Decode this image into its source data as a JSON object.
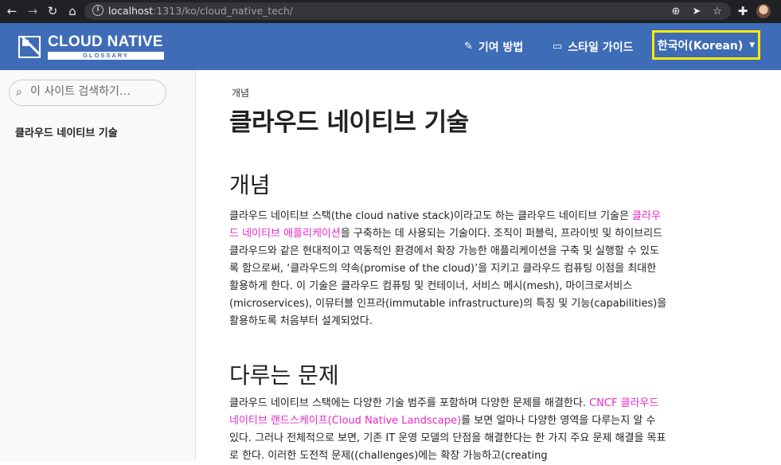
{
  "browser": {
    "url_host": "localhost",
    "url_rest": ":1313/ko/cloud_native_tech/"
  },
  "header": {
    "logo_title": "CLOUD NATIVE",
    "logo_subtitle": "GLOSSARY",
    "nav_contribute": "기여 방법",
    "nav_style_guide": "스타일 가이드",
    "language": "한국어(Korean)"
  },
  "sidebar": {
    "search_placeholder": "이 사이트 검색하기…",
    "item": "클라우드 네이티브 기술"
  },
  "content": {
    "breadcrumb": "개념",
    "title": "클라우드 네이티브 기술",
    "section1_heading": "개념",
    "p1_a": "클라우드 네이티브 스택(the cloud native stack)이라고도 하는 클라우드 네이티브 기술은 ",
    "p1_link": "클라우드 네이티브 애플리케이션",
    "p1_b": "을 구축하는 데 사용되는 기술이다. 조직이 퍼블릭, 프라이빗 및 하이브리드 클라우드와 같은 현대적이고 역동적인 환경에서 확장 가능한 애플리케이션을 구축 및 실행할 수 있도록 함으로써, ‘클라우드의 약속(promise of the cloud)’을 지키고 클라우드 컴퓨팅 이점을 최대한 활용하게 한다. 이 기술은 클라우드 컴퓨팅 및 컨테이너, 서비스 메시(mesh), 마이크로서비스(microservices), 이뮤터블 인프라(immutable infrastructure)의 특징 및 기능(capabilities)을 활용하도록 처음부터 설계되었다.",
    "section2_heading": "다루는 문제",
    "p2_a": "클라우드 네이티브 스택에는 다양한 기술 범주를 포함하며 다양한 문제를 해결한다. ",
    "p2_link": "CNCF 클라우드 네이티브 랜드스케이프(Cloud Native Landscape)",
    "p2_b": "를 보면 얼마나 다양한 영역을 다루는지 알 수 있다. 그러나 전체적으로 보면, 기존 IT 운영 모델의 단점을 해결한다는 한 가지 주요 문제 해결을 목표로 한다. 이러한 도전적 문제((challenges)에는 확장 가능하고(creating"
  }
}
